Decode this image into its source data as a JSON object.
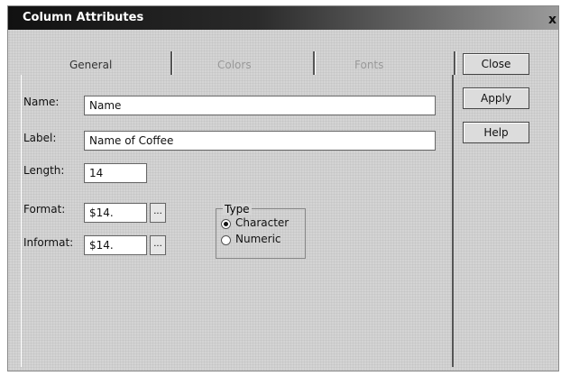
{
  "window": {
    "title": "Column Attributes",
    "close_glyph": "x"
  },
  "tabs": [
    {
      "label": "General",
      "active": true
    },
    {
      "label": "Colors",
      "active": false
    },
    {
      "label": "Fonts",
      "active": false
    }
  ],
  "fields": {
    "name": {
      "label": "Name:",
      "value": "Name"
    },
    "label": {
      "label": "Label:",
      "value": "Name of Coffee"
    },
    "length": {
      "label": "Length:",
      "value": "14"
    },
    "format": {
      "label": "Format:",
      "value": "$14.",
      "browse": "..."
    },
    "informat": {
      "label": "Informat:",
      "value": "$14.",
      "browse": "..."
    }
  },
  "type_group": {
    "title": "Type",
    "options": [
      {
        "label": "Character",
        "selected": true
      },
      {
        "label": "Numeric",
        "selected": false
      }
    ]
  },
  "buttons": {
    "close": "Close",
    "apply": "Apply",
    "help": "Help"
  }
}
